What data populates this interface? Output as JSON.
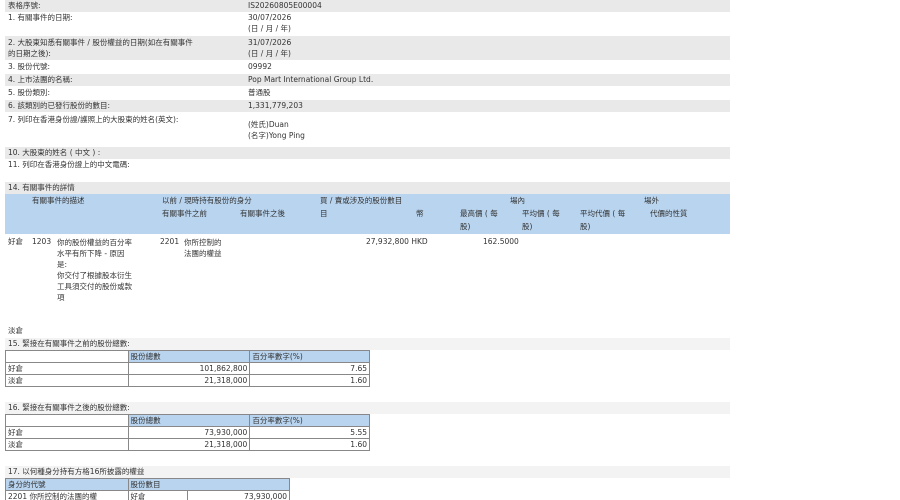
{
  "form": {
    "serial_label": "表格序號:",
    "serial_value": "IS20260805E00004",
    "r1_label": "1. 有關事件的日期:",
    "r1_value": "30/07/2026",
    "r1_fmt": "(日 / 月 / 年)",
    "r2_label_a": "2. 大股東知悉有關事件 / 股份權益的日期(如在有關事件",
    "r2_label_b": "的日期之後):",
    "r2_value": "31/07/2026",
    "r2_fmt": "(日 / 月 / 年)",
    "r3_label": "3. 股份代號:",
    "r3_value": "09992",
    "r4_label": "4. 上市法團的名稱:",
    "r4_value": "Pop Mart International Group Ltd.",
    "r5_label": "5. 股份類別:",
    "r5_value": "普通股",
    "r6_label": "6. 該類別的已發行股份的數目:",
    "r6_value": "1,331,779,203",
    "r7_label": "7. 列印在香港身份證/護照上的大股東的姓名(英文):",
    "r7_surname": "(姓氏)Duan",
    "r7_given": "(名字)Yong Ping",
    "r10_label": "10. 大股東的姓名 ( 中文 ) :",
    "r11_label": "11. 列印在香港身份證上的中文電碼:"
  },
  "s14": {
    "title": "14. 有關事件的詳情",
    "h_desc": "有關事件的描述",
    "h_cap": "以前 / 現時持有股份的身分",
    "h_before": "有關事件之前",
    "h_after": "有關事件之後",
    "h_num_a": "買 / 賣或涉及的股份數目",
    "h_num_b": "目",
    "h_onex": "場內",
    "h_offex": "場外",
    "h_high_a": "最高價 ( 每",
    "h_high_b": "股)",
    "h_avg_a": "平均價 ( 每",
    "h_avg_b": "股)",
    "h_avgc_a": "平均代價 ( 每",
    "h_avgc_b": "股)",
    "h_cons": "代價的性質",
    "h_curr": "幣",
    "row_pos": "好倉",
    "row_code": "1203",
    "row_desc_1": "你的股份權益的百分率",
    "row_desc_2": "水平有所下降 - 原因",
    "row_desc_3": "是:",
    "row_desc_4": "你交付了根據股本衍生",
    "row_desc_5": "工具須交付的股份或款",
    "row_desc_6": "項",
    "row_cap_code": "2201",
    "row_cap_1": "你所控制的",
    "row_cap_2": "法團的權益",
    "row_amount": "27,932,800 HKD",
    "row_price": "162.5000",
    "short_label": "淡倉"
  },
  "s15": {
    "title": "15. 緊接在有關事件之前的股份總數:",
    "col_shares": "股份總數",
    "col_pct": "百分率數字(%)",
    "rows": [
      {
        "pos": "好倉",
        "shares": "101,862,800",
        "pct": "7.65"
      },
      {
        "pos": "淡倉",
        "shares": "21,318,000",
        "pct": "1.60"
      }
    ]
  },
  "s16": {
    "title": "16. 緊接在有關事件之後的股份總數:",
    "col_shares": "股份總數",
    "col_pct": "百分率數字(%)",
    "rows": [
      {
        "pos": "好倉",
        "shares": "73,930,000",
        "pct": "5.55"
      },
      {
        "pos": "淡倉",
        "shares": "21,318,000",
        "pct": "1.60"
      }
    ]
  },
  "s17": {
    "title": "17. 以何種身分持有方格16所披露的權益",
    "col_code": "身分的代號",
    "col_shares": "股份數目",
    "row_code": "2201 你所控制的法團的權",
    "row_pos": "好倉",
    "row_shares": "73,930,000"
  }
}
